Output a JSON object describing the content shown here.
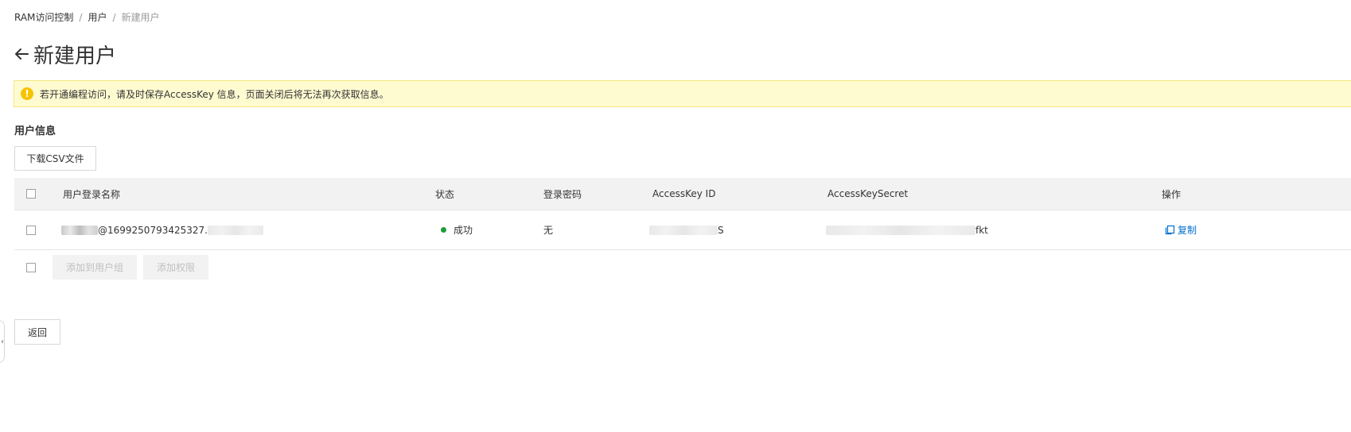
{
  "breadcrumb": {
    "items": [
      "RAM访问控制",
      "用户",
      "新建用户"
    ],
    "separator": "/"
  },
  "page": {
    "title": "新建用户",
    "back_icon": "arrow-left-icon"
  },
  "alert": {
    "icon": "exclamation-icon",
    "text": "若开通编程访问，请及时保存AccessKey 信息，页面关闭后将无法再次获取信息。",
    "bg_color": "#fffbd1",
    "border_color": "#f4e77a"
  },
  "section": {
    "title": "用户信息"
  },
  "toolbar": {
    "download_label": "下载CSV文件"
  },
  "table": {
    "columns": [
      "用户登录名称",
      "状态",
      "登录密码",
      "AccessKey ID",
      "AccessKeySecret",
      "操作"
    ],
    "rows": [
      {
        "login_name": "@1699250793425327.",
        "status": "成功",
        "password": "无",
        "access_key_id": "S",
        "access_key_secret": "fkt",
        "action": "复制"
      }
    ]
  },
  "footer": {
    "add_to_group_label": "添加到用户组",
    "add_permission_label": "添加权限"
  },
  "back_button_label": "返回",
  "colors": {
    "accent": "#0070cc",
    "success": "#1e9c3a",
    "warning": "#f5c400"
  }
}
